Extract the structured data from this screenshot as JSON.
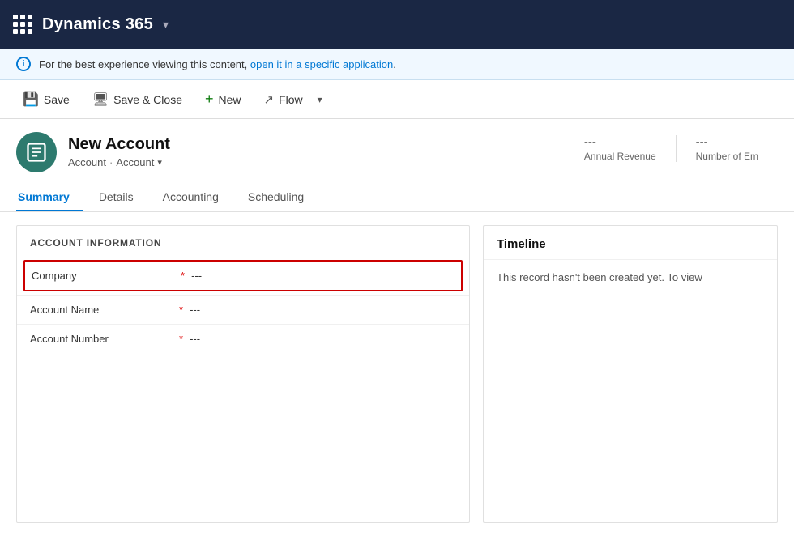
{
  "topbar": {
    "title": "Dynamics 365",
    "chevron": "▾"
  },
  "infoBanner": {
    "message": "For the best experience viewing this content, open it in a specific application.",
    "link_text": "open it in a specific application"
  },
  "toolbar": {
    "save_label": "Save",
    "save_close_label": "Save & Close",
    "new_label": "New",
    "flow_label": "Flow",
    "chevron": "▾"
  },
  "record": {
    "name": "New Account",
    "breadcrumb1": "Account",
    "breadcrumb_sep": "·",
    "breadcrumb2": "Account",
    "stats": [
      {
        "value": "---",
        "label": "Annual Revenue"
      },
      {
        "value": "---",
        "label": "Number of Em"
      }
    ]
  },
  "tabs": [
    {
      "label": "Summary",
      "active": true
    },
    {
      "label": "Details",
      "active": false
    },
    {
      "label": "Accounting",
      "active": false
    },
    {
      "label": "Scheduling",
      "active": false
    }
  ],
  "leftPanel": {
    "title": "ACCOUNT INFORMATION",
    "fields": [
      {
        "label": "Company",
        "required": true,
        "value": "---",
        "highlighted": true
      },
      {
        "label": "Account Name",
        "required": true,
        "value": "---",
        "highlighted": false
      },
      {
        "label": "Account Number",
        "required": true,
        "value": "---",
        "highlighted": false
      }
    ]
  },
  "rightPanel": {
    "title": "Timeline",
    "empty_message": "This record hasn't been created yet.  To view"
  },
  "avatar": {
    "icon": "🗒",
    "bg": "#2d7a6e"
  }
}
